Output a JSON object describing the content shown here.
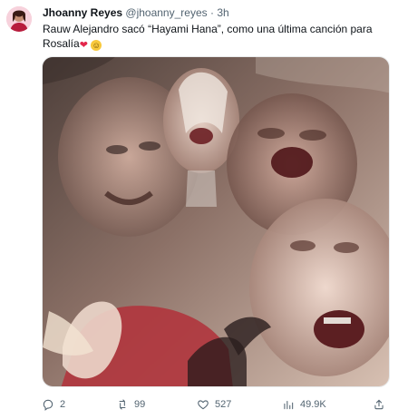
{
  "tweet": {
    "author_name": "Jhoanny Reyes",
    "author_handle": "@jhoanny_reyes",
    "separator": "·",
    "time": "3h",
    "text": "Rauw Alejandro sacó “Hayami Hana”, como una última canción para Rosalía",
    "emojis": [
      "heart-with-ribbon",
      "smiling-face"
    ],
    "media": {
      "type": "collage-photo",
      "icon": "image-icon"
    },
    "actions": {
      "reply_count": "2",
      "retweet_count": "99",
      "like_count": "527",
      "views_count": "49.9K"
    }
  },
  "colors": {
    "text_primary": "#0f1419",
    "text_secondary": "#536471",
    "border": "#e7e9ea",
    "heart": "#e3264b",
    "smile": "#f8c93c"
  }
}
